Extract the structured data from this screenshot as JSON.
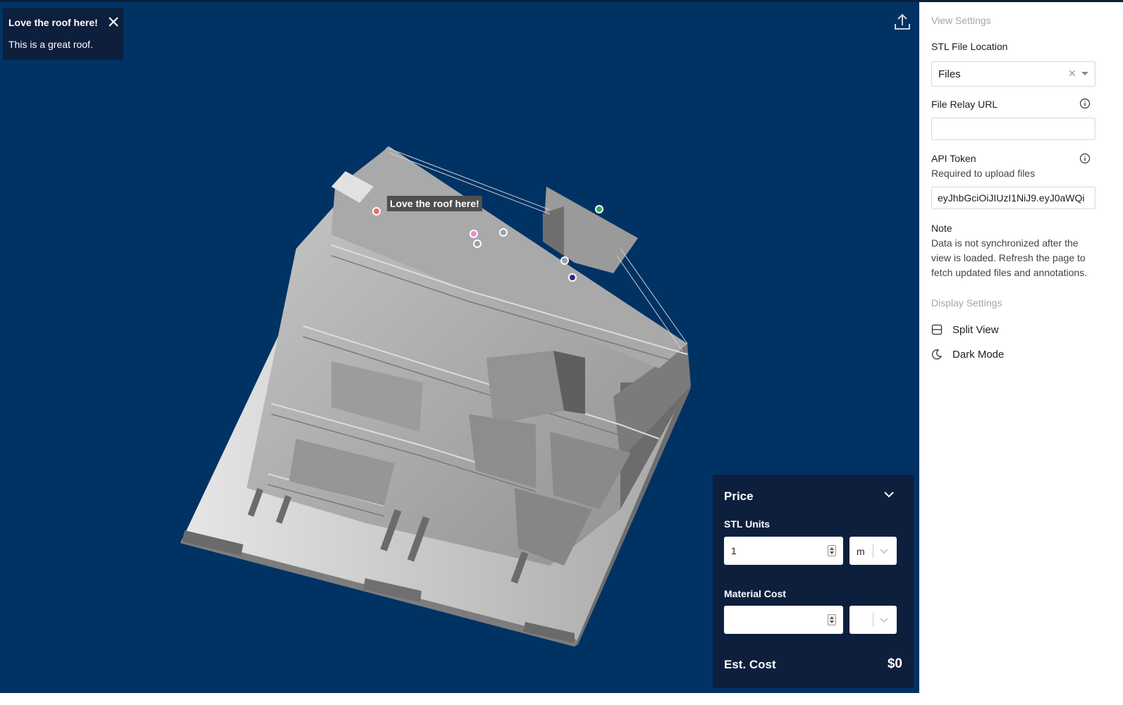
{
  "popup": {
    "title": "Love the roof here!",
    "body": "This is a great roof."
  },
  "viewer": {
    "background": "#003264",
    "model_label": "Love the roof here!",
    "markers": [
      {
        "color": "#f26b6b"
      },
      {
        "color": "#22b05a"
      },
      {
        "color": "#f08ad6"
      },
      {
        "color": "#9aa0a6"
      },
      {
        "color": "#9aa0a6"
      },
      {
        "color": "#9aa0a6"
      },
      {
        "color": "#3a1f8c"
      }
    ]
  },
  "price": {
    "title": "Price",
    "stl_units_label": "STL Units",
    "stl_units_value": "1",
    "stl_units_unit": "m",
    "material_cost_label": "Material Cost",
    "material_cost_value": "",
    "material_cost_unit": "",
    "est_cost_label": "Est. Cost",
    "est_cost_value": "$0"
  },
  "settings": {
    "view_settings_heading": "View Settings",
    "stl_file_location_label": "STL File Location",
    "stl_file_location_value": "Files",
    "file_relay_url_label": "File Relay URL",
    "file_relay_url_value": "",
    "api_token_label": "API Token",
    "api_token_hint": "Required to upload files",
    "api_token_value": "eyJhbGciOiJIUzI1NiJ9.eyJ0aWQi",
    "note_label": "Note",
    "note_text": "Data is not synchronized after the view is loaded. Refresh the page to fetch updated files and annotations.",
    "display_settings_heading": "Display Settings",
    "split_view_label": "Split View",
    "dark_mode_label": "Dark Mode"
  }
}
